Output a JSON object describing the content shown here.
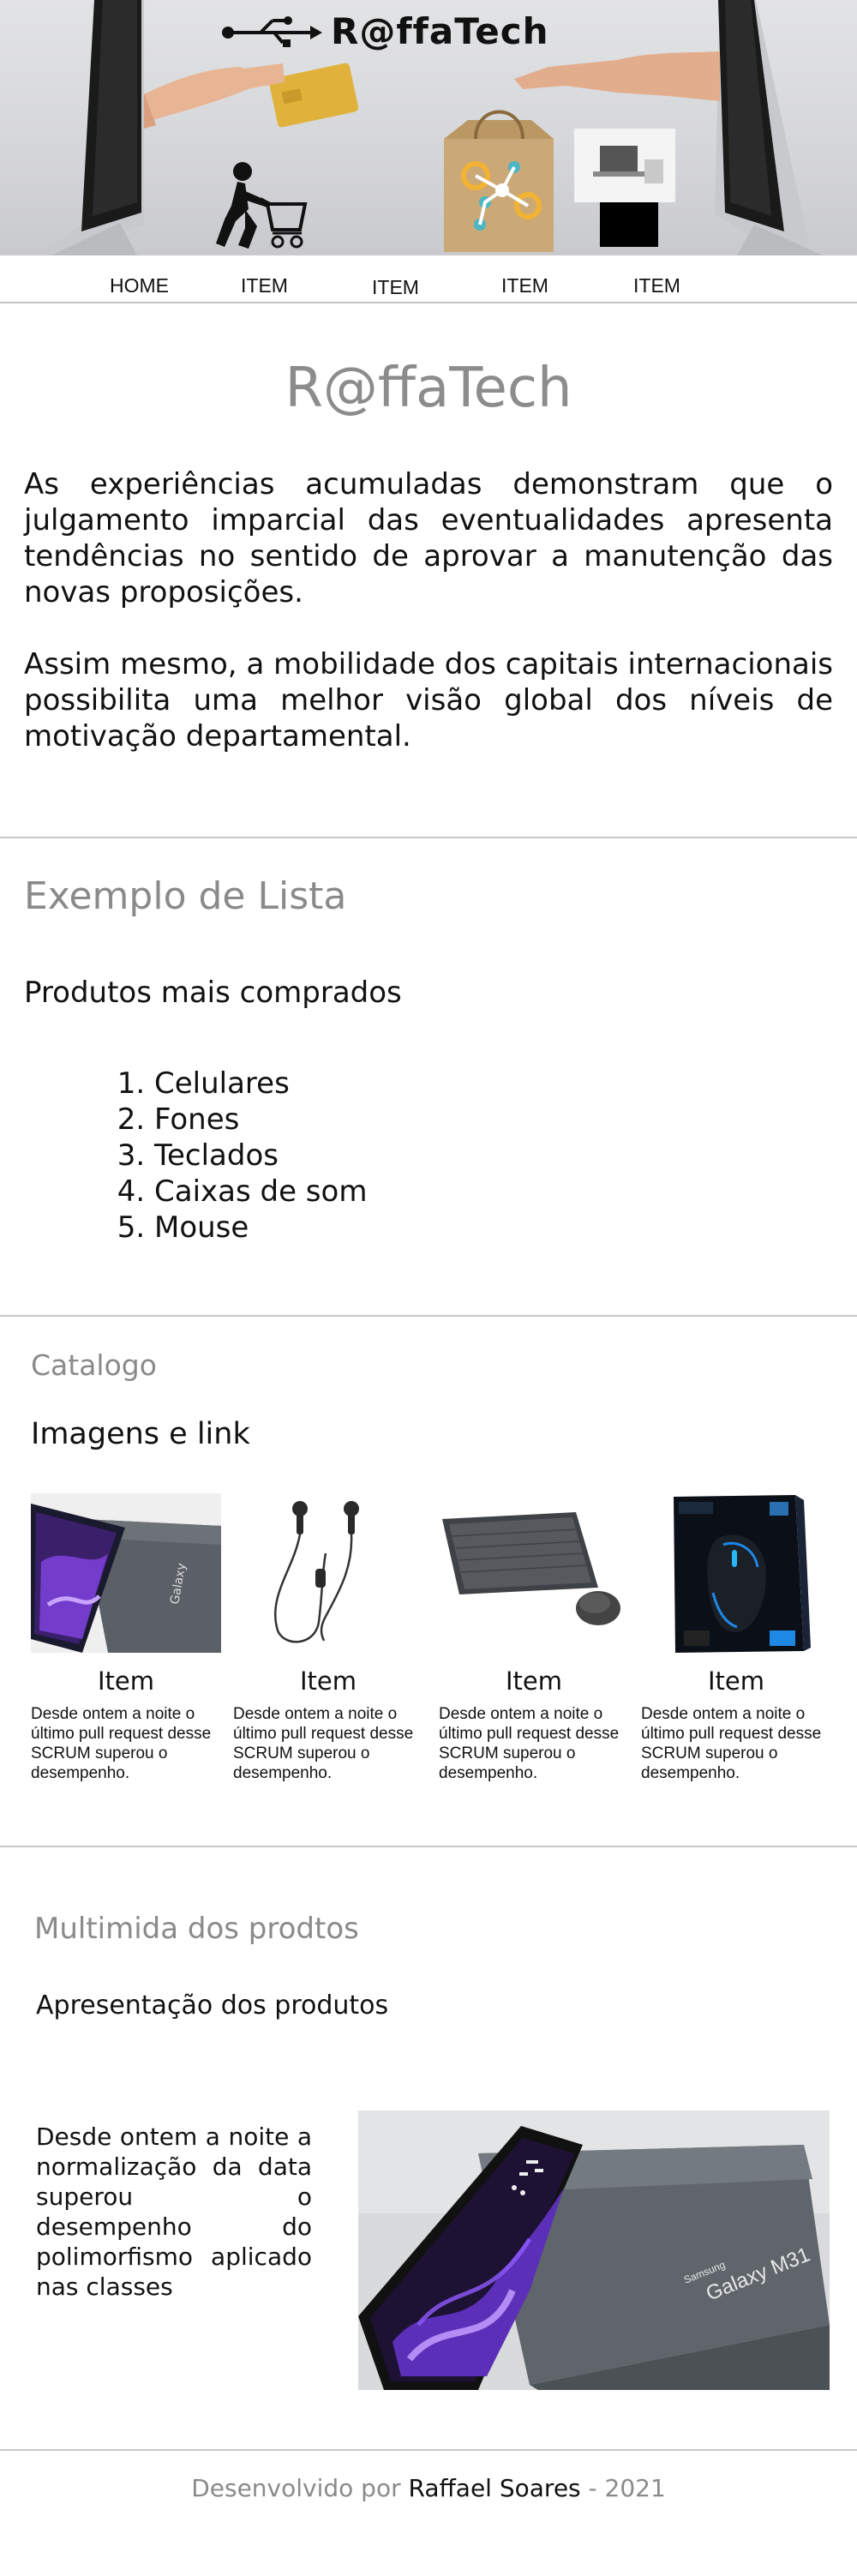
{
  "brand": {
    "name": "R@ffaTech",
    "logo_icon": "usb-icon"
  },
  "nav": {
    "items": [
      "HOME",
      "ITEM",
      "ITEM",
      "ITEM",
      "ITEM"
    ]
  },
  "intro": {
    "title": "R@ffaTech",
    "paragraphs": [
      "As experiências acumuladas demonstram que o julgamento imparcial das eventualidades apresenta tendências no sentido de aprovar a manutenção das novas proposições.",
      "Assim mesmo, a mobilidade dos capitais internacionais possibilita uma melhor visão global dos níveis de motivação departamental."
    ]
  },
  "list_section": {
    "title": "Exemplo de Lista",
    "subtitle": "Produtos mais comprados",
    "items": [
      "Celulares",
      "Fones",
      "Teclados",
      "Caixas de som",
      "Mouse"
    ]
  },
  "catalog": {
    "title": "Catalogo",
    "subtitle": "Imagens e link",
    "items": [
      {
        "title": "Item",
        "text": "Desde ontem a noite o último pull request desse SCRUM superou o desempenho.",
        "image": "smartphone-box"
      },
      {
        "title": "Item",
        "text": "Desde ontem a noite o último pull request desse SCRUM superou o desempenho.",
        "image": "earphones"
      },
      {
        "title": "Item",
        "text": "Desde ontem a noite o último pull request desse SCRUM superou o desempenho.",
        "image": "keyboard-mouse"
      },
      {
        "title": "Item",
        "text": "Desde ontem a noite o último pull request desse SCRUM superou o desempenho.",
        "image": "gaming-mouse-box"
      }
    ]
  },
  "multimedia": {
    "title": "Multimida dos prodtos",
    "subtitle": "Apresentação dos produtos",
    "text": "Desde ontem a noite a normalização da data superou o desempenho do polimorfismo aplicado nas classes",
    "image_caption_brand": "Samsung",
    "image_caption_model": "Galaxy M31"
  },
  "footer": {
    "prefix": "Desenvolvido por",
    "author": "Raffael Soares",
    "suffix": "- 2021"
  },
  "colors": {
    "muted": "#8a8a8a",
    "divider": "#c8c8c8",
    "text": "#111111"
  }
}
